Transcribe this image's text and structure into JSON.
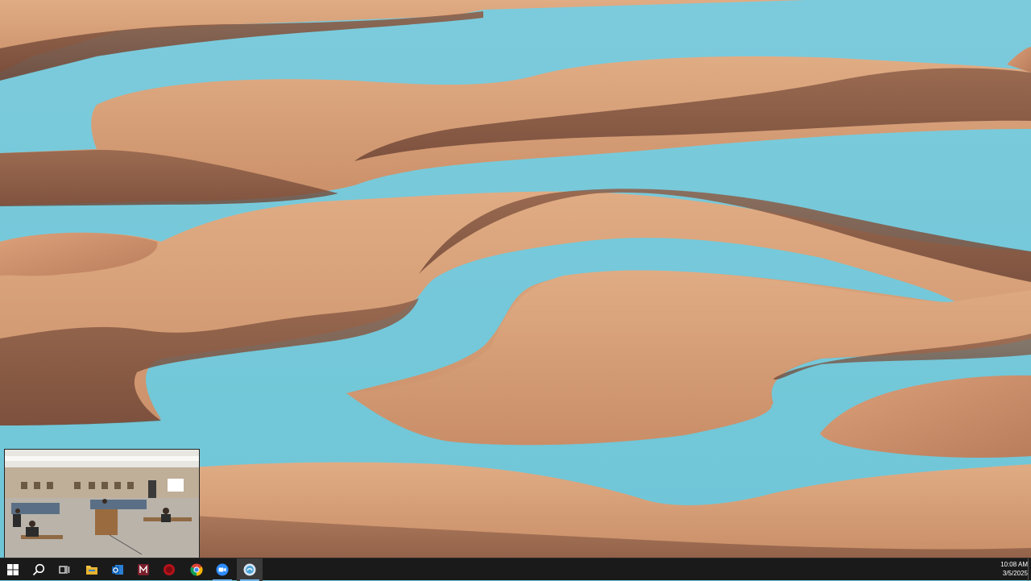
{
  "desktop": {
    "wallpaper": "sand dunes and turquoise water",
    "colors": {
      "water": "#72c8d9",
      "sand": "#d8a27a",
      "shadow": "#8a5c46"
    }
  },
  "video_thumbnail": {
    "scene": "meeting room camera feed"
  },
  "taskbar": {
    "background": "#1a1a1a",
    "items": [
      {
        "name": "start-button",
        "icon": "windows-logo-icon"
      },
      {
        "name": "search-button",
        "icon": "search-icon"
      },
      {
        "name": "task-view-button",
        "icon": "task-view-icon"
      },
      {
        "name": "file-explorer-button",
        "icon": "folder-icon"
      },
      {
        "name": "outlook-button",
        "icon": "outlook-icon"
      },
      {
        "name": "media-app-button",
        "icon": "media-app-icon"
      },
      {
        "name": "red-circle-app-button",
        "icon": "red-circle-icon"
      },
      {
        "name": "chrome-button",
        "icon": "chrome-icon"
      },
      {
        "name": "zoom-button",
        "icon": "zoom-icon"
      },
      {
        "name": "meeting-app-button",
        "icon": "meeting-app-icon"
      }
    ],
    "clock": {
      "time": "10:08 AM",
      "date": "3/5/2025"
    }
  }
}
